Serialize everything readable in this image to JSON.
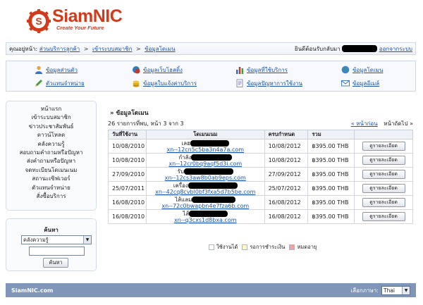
{
  "brand": {
    "name": "SiamNIC",
    "tagline": "Create Your Future"
  },
  "breadcrumb": {
    "prefix": "คุณอยู่หน้า:",
    "items": [
      "ส่วนบริการลูกค้า",
      "เข้าระบบสมาชิก",
      "ข้อมูลโดเมน"
    ],
    "separator": ">"
  },
  "welcome": {
    "text": "ยินดีต้อนรับกลับมา",
    "logout": "ออกจากระบบ"
  },
  "quick_menu": [
    {
      "label": "ข้อมูลส่วนตัว",
      "icon": "user-icon",
      "color": "#3a6fc4"
    },
    {
      "label": "ข้อมูลเว็บโฮสติ้ง",
      "icon": "hosting-icon",
      "color": "#c0392b"
    },
    {
      "label": "ข้อมูลที่ใช้บริการ",
      "icon": "chart-icon",
      "color": "#2f6fb5"
    },
    {
      "label": "ข้อมูลโดเมน",
      "icon": "globe-icon",
      "color": "#2e9c5a"
    },
    {
      "label": "ตัวแทนจำหน่าย",
      "icon": "pencil-icon",
      "color": "#4a9a3a"
    },
    {
      "label": "ข้อมูลใบแจ้งค่าบริการ",
      "icon": "coins-icon",
      "color": "#d4a017"
    },
    {
      "label": "ข้อมูลปัญหาการใช้งาน",
      "icon": "document-icon",
      "color": "#6d5bbf"
    },
    {
      "label": "ข้อมูลอีเมล์",
      "icon": "mail-icon",
      "color": "#2f6fb5"
    }
  ],
  "sidebar": {
    "items": [
      "หน้าแรก",
      "เข้าระบบสมาชิก",
      "ข่าวประชาสัมพันธ์",
      "ดาวน์โหลด",
      "คลังความรู้",
      "สอบถามคำถามหรือปัญหา",
      "ส่งคำถามหรือปัญหา",
      "จดทะเบียนโดเมนเนม",
      "สถานะเซิฟเวอร์",
      "ตัวแทนจำหน่าย",
      "สั่งซื้อบริการ"
    ]
  },
  "search": {
    "title": "ค้นหา",
    "selected": "คลังความรู้",
    "input_value": "",
    "button": "ค้นหา"
  },
  "main": {
    "title": "ข้อมูลโดเมน",
    "summary": "26 รายการที่พบ, หน้า 3 จาก 3",
    "pager": {
      "prev": "« หน้าก่อน",
      "next": "หน้าถัดไป »"
    },
    "columns": [
      "วันที่ใช้งาน",
      "โดเมนเนม",
      "ครบกำหนด",
      "รวม",
      ""
    ],
    "rows": [
      {
        "start": "10/08/2010",
        "name": "เลฮ",
        "punycode": "xn--12cn5c5ba3n4a7a.com",
        "due": "10/08/2012",
        "total": "฿395.00 THB",
        "action": "ดูรายละเอียด"
      },
      {
        "start": "10/08/2010",
        "name": "กำลัง",
        "punycode": "xn--12cr0bq9aqf5d3i.com",
        "due": "10/08/2012",
        "total": "฿395.00 THB",
        "action": "ดูรายละเอียด"
      },
      {
        "start": "27/09/2010",
        "name": "รับ",
        "punycode": "xn--12cs3aw8b0ab9eps.com",
        "due": "27/09/2012",
        "total": "฿395.00 THB",
        "action": "ดูรายละเอียด"
      },
      {
        "start": "25/07/2011",
        "name": "เครื่อง",
        "punycode": "xn--42cq8cvbl0bf3fxa5d7b5be.com",
        "due": "25/07/2012",
        "total": "฿395.00 THB",
        "action": "ดูรายละเอียด"
      },
      {
        "start": "16/08/2010",
        "name": "ไส้แลม",
        "punycode": "xn--72c0bwapbn4e7fza6b.com",
        "due": "16/08/2012",
        "total": "฿395.00 THB",
        "action": "ดูรายละเอียด"
      },
      {
        "start": "16/08/2010",
        "name": "ไส้",
        "punycode": "xn--q3cxs1d8bxa.com",
        "due": "16/08/2012",
        "total": "฿395.00 THB",
        "action": "ดูรายละเอียด"
      }
    ],
    "legend": [
      {
        "label": "ใช้งานได้",
        "color": "#ffffff"
      },
      {
        "label": "รอการชำระเงิน",
        "color": "#fff6c8"
      },
      {
        "label": "หมดอายุ",
        "color": "#f2a0a0"
      }
    ]
  },
  "footer": {
    "site": "SiamNIC.com",
    "language_label": "เลือกภาษา:",
    "language_value": "Thai"
  },
  "colors": {
    "brand_red": "#d23a1c",
    "link": "#1a55a8",
    "footer_bg": "#7f96b9"
  }
}
